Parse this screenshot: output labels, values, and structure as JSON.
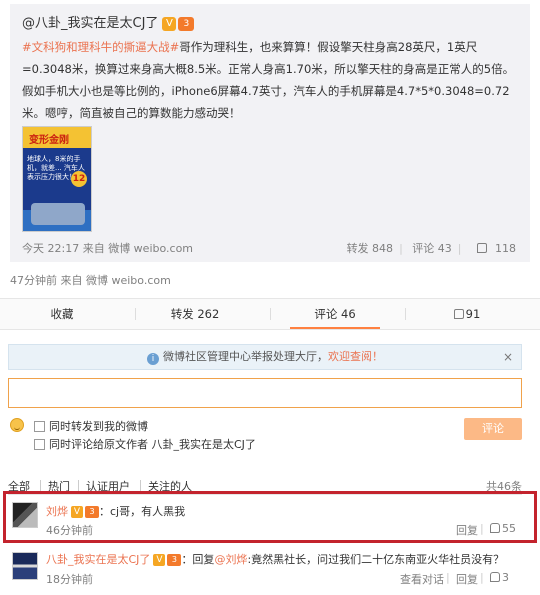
{
  "original_post": {
    "author": "@八卦_我实在是太CJ了",
    "verified_badge": "V",
    "level_badge": "3",
    "hashtag": "#文科狗和理科牛的撕逼大战#",
    "body": "哥作为理科生，也来算算！假设擎天柱身高28英尺，1英尺=0.3048米，换算过来身高大概8.5米。正常人身高1.70米，所以擎天柱的身高是正常人的5倍。假如手机大小也是等比例的，iPhone6屏幕4.7英寸，汽车人的手机屏幕是4.7*5*0.3048=0.72米。嗯哼，简直被自己的算数能力感动哭！",
    "image_title": "变形金刚",
    "image_text": "地球人，8米的手机，就差... 汽车人表示压力很大！",
    "image_badge": "12",
    "timestamp": "今天 22:17 来自 微博 weibo.com",
    "repost": "转发 848",
    "comment": "评论 43",
    "like": "118"
  },
  "post_time": "47分钟前 来自 微博 weibo.com",
  "tabs": [
    {
      "label": "收藏"
    },
    {
      "label": "转发 262"
    },
    {
      "label": "评论 46"
    },
    {
      "label": "91"
    }
  ],
  "notice": {
    "icon": "i",
    "text": "微博社区管理中心举报处理大厅，",
    "link": "欢迎查阅！",
    "close": "×"
  },
  "compose": {
    "input_value": "",
    "repost_option": "同时转发到我的微博",
    "comment_option": "同时评论给原文作者 八卦_我实在是太CJ了",
    "submit": "评论"
  },
  "filters": {
    "all": "全部",
    "hot": "热门",
    "verified": "认证用户",
    "following": "关注的人",
    "count": "共46条"
  },
  "comments": [
    {
      "user": "刘烨",
      "text": "：cj哥，有人黑我",
      "time": "46分钟前",
      "reply": "回复",
      "likes": "55"
    },
    {
      "user": "八卦_我实在是太CJ了",
      "text_prefix": "：回复",
      "mention": "@刘烨",
      "text_suffix": ":竟然黑社长，问过我们二十亿东南亚火华社员没有？",
      "time": "18分钟前",
      "view_conv": "查看对话",
      "reply": "回复",
      "likes": "3"
    }
  ],
  "colors": {
    "accent": "#eb7350",
    "highlight_border": "#c3232d",
    "submit_bg": "#fcb986"
  }
}
